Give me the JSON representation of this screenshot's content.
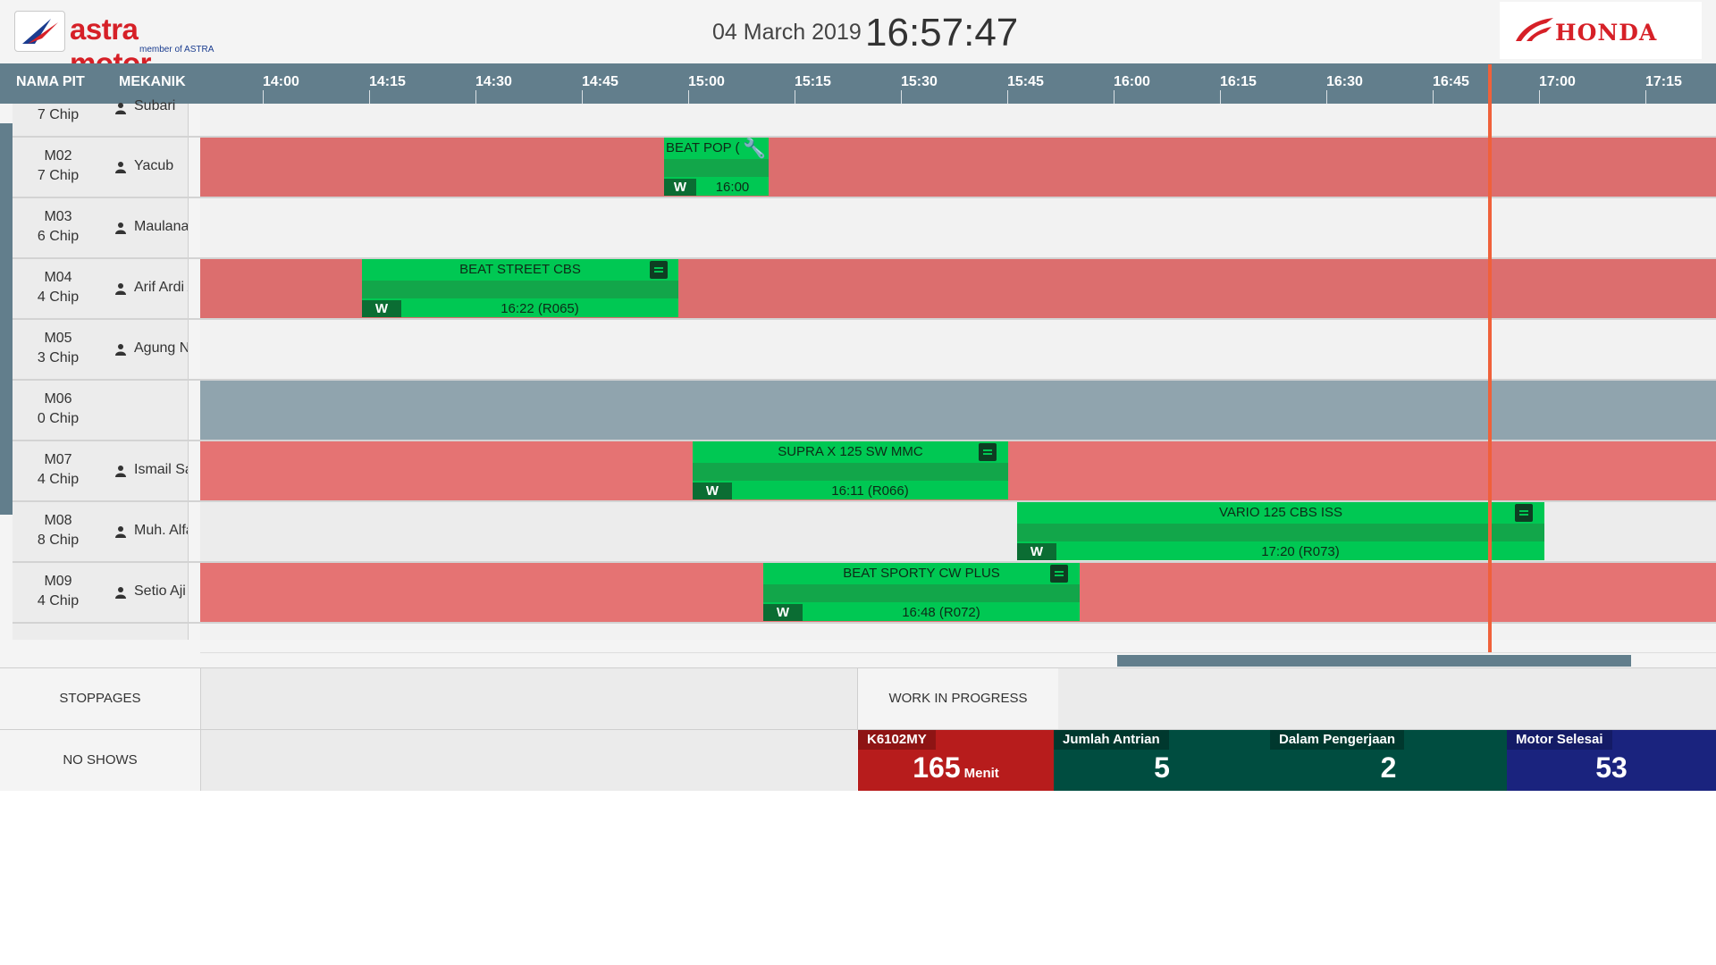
{
  "header": {
    "brand_name": "astra motor",
    "brand_sub": "member of ASTRA",
    "date": "04 March 2019",
    "time": "16:57:47",
    "honda_logo": "HONDA"
  },
  "columns": {
    "pit": "NAMA PIT",
    "mechanic": "MEKANIK"
  },
  "time_ticks": [
    "14:00",
    "14:15",
    "14:30",
    "14:45",
    "15:00",
    "15:15",
    "15:30",
    "15:45",
    "16:00",
    "16:15",
    "16:30",
    "16:45",
    "17:00",
    "17:15"
  ],
  "rows": [
    {
      "code": "",
      "chip": "7 Chip",
      "mechanic": "Subari",
      "lane": "idle",
      "job": null
    },
    {
      "code": "M02",
      "chip": "7 Chip",
      "mechanic": "Yacub",
      "lane": "late",
      "job": {
        "title": "BEAT POP (",
        "w": "W",
        "end": "16:00",
        "icon": "wrench"
      }
    },
    {
      "code": "M03",
      "chip": "6 Chip",
      "mechanic": "Maulana Id",
      "lane": "idle",
      "job": null
    },
    {
      "code": "M04",
      "chip": "4 Chip",
      "mechanic": "Arif Ardi A",
      "lane": "late",
      "job": {
        "title": "BEAT STREET CBS",
        "w": "W",
        "end": "16:22 (R065)",
        "icon": "clipboard"
      }
    },
    {
      "code": "M05",
      "chip": "3 Chip",
      "mechanic": "Agung Nop",
      "lane": "idle",
      "job": null
    },
    {
      "code": "M06",
      "chip": "0 Chip",
      "mechanic": "",
      "lane": "off",
      "job": null
    },
    {
      "code": "M07",
      "chip": "4 Chip",
      "mechanic": "Ismail Sale",
      "lane": "late",
      "job": {
        "title": "SUPRA X 125 SW MMC",
        "w": "W",
        "end": "16:11 (R066)",
        "icon": "clipboard"
      }
    },
    {
      "code": "M08",
      "chip": "8 Chip",
      "mechanic": "Muh. Alfar",
      "lane": "idle",
      "job": {
        "title": "VARIO 125 CBS ISS",
        "w": "W",
        "end": "17:20 (R073)",
        "icon": "clipboard"
      }
    },
    {
      "code": "M09",
      "chip": "4 Chip",
      "mechanic": "Setio Aji",
      "lane": "late",
      "job": {
        "title": "BEAT SPORTY CW PLUS",
        "w": "W",
        "end": "16:48 (R072)",
        "icon": "clipboard"
      }
    }
  ],
  "colors": {
    "header_bar": "#627e8c",
    "lane_late": "#e57373",
    "lane_idle": "#f2f2f2",
    "lane_off": "#90a4ae",
    "job_bar": "#00c853",
    "now_line": "#f0613a"
  },
  "bottom": {
    "stoppages": "STOPPAGES",
    "no_shows": "NO SHOWS",
    "wip": "WORK IN PROGRESS"
  },
  "stats": {
    "plate": {
      "label": "K6102MY",
      "value": "165",
      "unit": "Menit",
      "color": "#b71c1c"
    },
    "queue": {
      "label": "Jumlah Antrian",
      "value": "5",
      "color": "#004d40"
    },
    "in_progress": {
      "label": "Dalam Pengerjaan",
      "value": "2",
      "color": "#004d40"
    },
    "done": {
      "label": "Motor Selesai",
      "value": "53",
      "color": "#1a237e"
    }
  }
}
